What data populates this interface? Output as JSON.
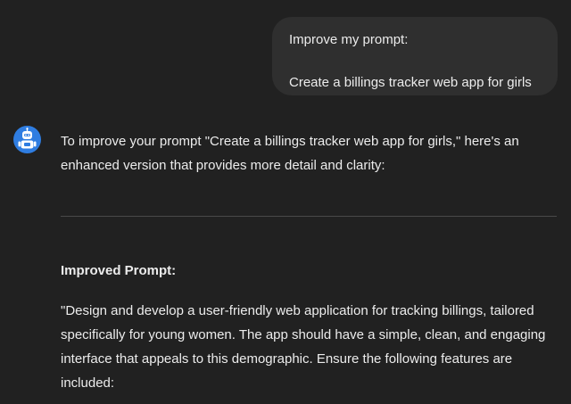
{
  "conversation": {
    "user_message": {
      "line1": "Improve my prompt:",
      "line2": "Create a billings tracker web app for girls"
    },
    "assistant": {
      "avatar_icon": "robot-avatar-icon",
      "avatar_color": "#2f7de1",
      "intro": "To improve your prompt \"Create a billings tracker web app for girls,\" here's an enhanced version that provides more detail and clarity:",
      "section_heading": "Improved Prompt:",
      "body": "\"Design and develop a user-friendly web application for tracking billings, tailored specifically for young women. The app should have a simple, clean, and engaging interface that appeals to this demographic. Ensure the following features are included:"
    }
  },
  "colors": {
    "background": "#212121",
    "user_bubble": "#2f2f2f",
    "text": "#ececec",
    "divider": "#4a4a4a"
  }
}
